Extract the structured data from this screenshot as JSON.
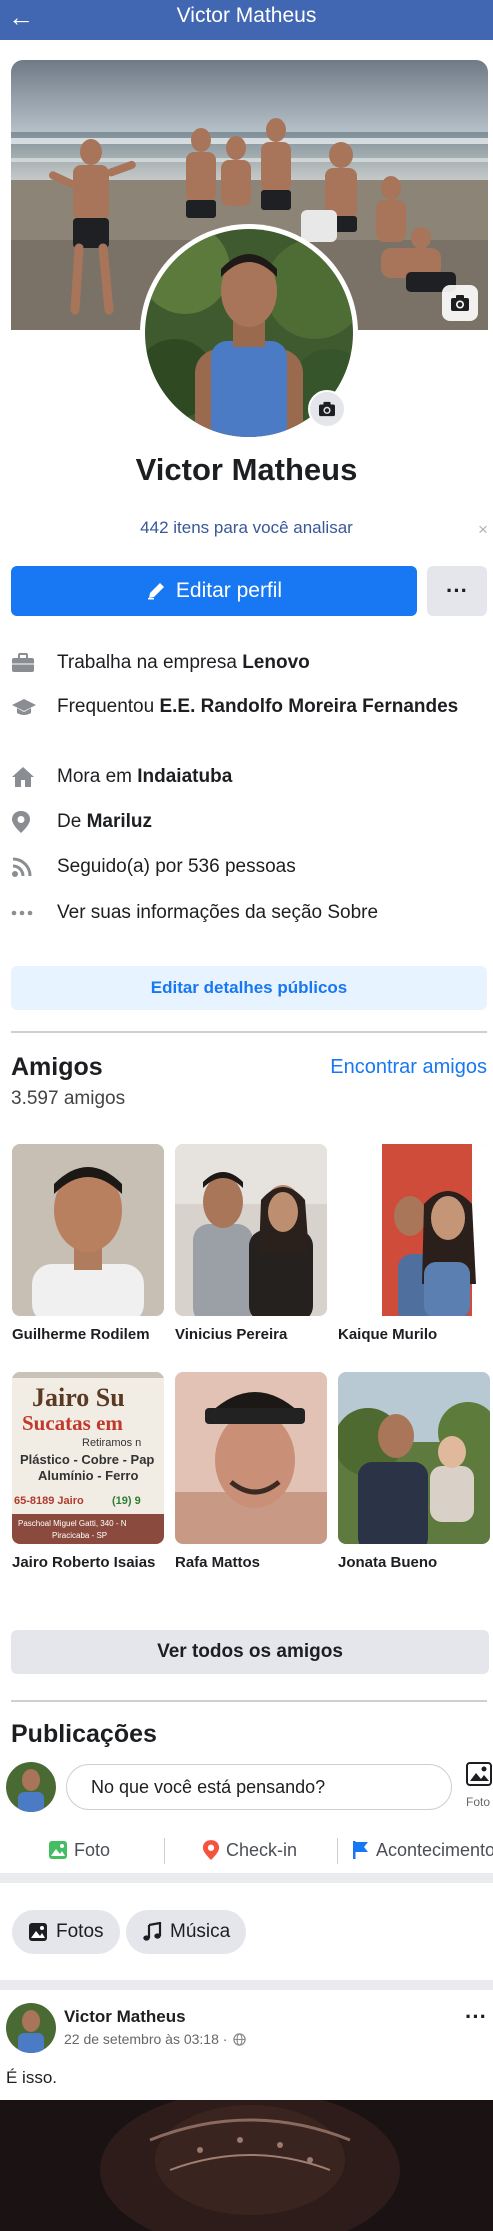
{
  "topbar": {
    "back_icon": "arrow-left-icon",
    "title": "Victor Matheus"
  },
  "profile": {
    "name": "Victor Matheus",
    "review_link": "442 itens para você analisar",
    "close": "×",
    "edit_label": "Editar perfil",
    "more_label": "···"
  },
  "info": {
    "work_prefix": "Trabalha na empresa ",
    "work_value": "Lenovo",
    "school_prefix": "Frequentou ",
    "school_value": "E.E. Randolfo Moreira Fernandes",
    "lives_prefix": "Mora em ",
    "lives_value": "Indaiatuba",
    "from_prefix": "De ",
    "from_value": "Mariluz",
    "followers": "Seguido(a) por 536 pessoas",
    "about": "Ver suas informações da seção Sobre"
  },
  "public_details_label": "Editar detalhes públicos",
  "friends": {
    "title": "Amigos",
    "count": "3.597 amigos",
    "find_label": "Encontrar amigos",
    "items": [
      {
        "name": "Guilherme Rodilem"
      },
      {
        "name": "Vinicius Pereira"
      },
      {
        "name": "Kaique Murilo"
      },
      {
        "name": "Jairo Roberto Isaias"
      },
      {
        "name": "Rafa Mattos"
      },
      {
        "name": "Jonata Bueno"
      }
    ],
    "sign": {
      "line1": "Jairo Su",
      "line2": "Sucatas em",
      "line3": "Retiramos n",
      "line4": "Plástico - Cobre - Pap",
      "line5": "Alumínio - Ferro",
      "line6": "65-8189 Jairo",
      "line7": "(19) 9",
      "line8": "Paschoal Miguel Gatti, 340 - N",
      "line9": "Piracicaba - SP"
    },
    "see_all_label": "Ver todos os amigos"
  },
  "posts": {
    "title": "Publicações",
    "composer_placeholder": "No que você está pensando?",
    "photo_side_label": "Foto",
    "actions": {
      "photo": "Foto",
      "checkin": "Check-in",
      "event": "Acontecimento"
    },
    "chips": {
      "photos": "Fotos",
      "music": "Música"
    },
    "post": {
      "author": "Victor Matheus",
      "date": "22 de setembro às 03:18 ·",
      "text": "É isso.",
      "more": "···"
    }
  },
  "colors": {
    "header": "#4267b2",
    "primary": "#1877f2",
    "link": "#385898",
    "chip": "#e4e6eb"
  }
}
